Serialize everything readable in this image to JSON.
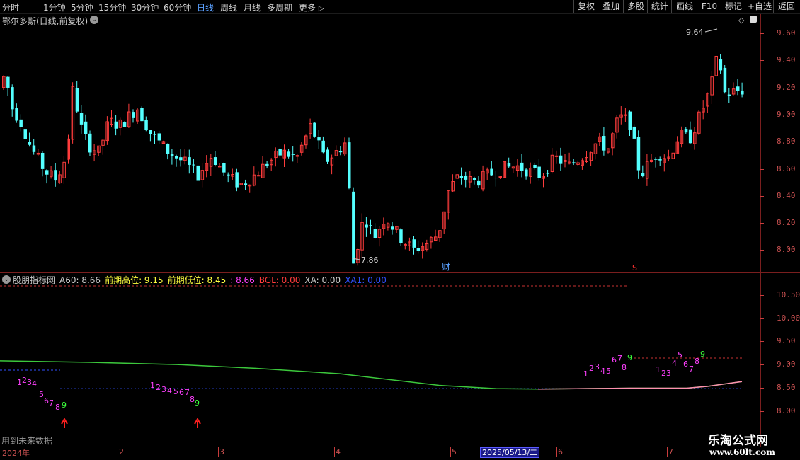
{
  "toolbar": {
    "periods": [
      "分时",
      "1分钟",
      "5分钟",
      "15分钟",
      "30分钟",
      "60分钟",
      "日线",
      "周线",
      "月线",
      "多周期",
      "更多"
    ],
    "active_period": "日线",
    "more_arrow": "▷",
    "right_buttons": [
      "复权",
      "叠加",
      "多股",
      "统计",
      "画线",
      "F10",
      "标记",
      "+自选",
      "返回"
    ]
  },
  "main_chart": {
    "title": "鄂尔多斯(日线,前复权)",
    "collapse_icon": "chevron-down-icon",
    "corner_icons": [
      "diamond-icon",
      "settings-icon"
    ],
    "high_label": "9.64",
    "low_label": "7.86",
    "finance_marker": "财",
    "s_marker": "S",
    "y_ticks": [
      "9.60",
      "9.40",
      "9.20",
      "9.00",
      "8.80",
      "8.60",
      "8.40",
      "8.20",
      "8.00"
    ],
    "colors": {
      "up": "#ff3c3c",
      "down": "#54ffff",
      "axis": "#c83c3c"
    }
  },
  "indicator": {
    "name": "股朋指标网",
    "values": [
      {
        "label": "A60:",
        "value": "8.66",
        "color": "#d0d0d0"
      },
      {
        "label": "前期高位:",
        "value": "9.15",
        "color": "#ffff40"
      },
      {
        "label": "前期低位:",
        "value": "8.45",
        "color": "#ffff40"
      },
      {
        "label": ":",
        "value": "8.66",
        "color": "#ff40ff"
      },
      {
        "label": "BGL:",
        "value": "0.00",
        "color": "#ff3c3c"
      },
      {
        "label": "XA:",
        "value": "0.00",
        "color": "#d0d0d0"
      },
      {
        "label": "XA1:",
        "value": "0.00",
        "color": "#3050ff"
      }
    ],
    "y_ticks": [
      "10.50",
      "10.00",
      "9.50",
      "9.00",
      "8.50",
      "8.00"
    ],
    "footer_note": "用到未来数据",
    "count_digits": [
      "1",
      "2",
      "3",
      "4",
      "5",
      "6",
      "7",
      "8",
      "9"
    ]
  },
  "time_axis": {
    "labels": [
      "2024年",
      "2",
      "3",
      "4",
      "5",
      "6",
      "7"
    ],
    "cursor_date": "2025/05/13/二"
  },
  "watermark": {
    "name": "乐淘公式网",
    "url": "www.60lt.com"
  }
}
